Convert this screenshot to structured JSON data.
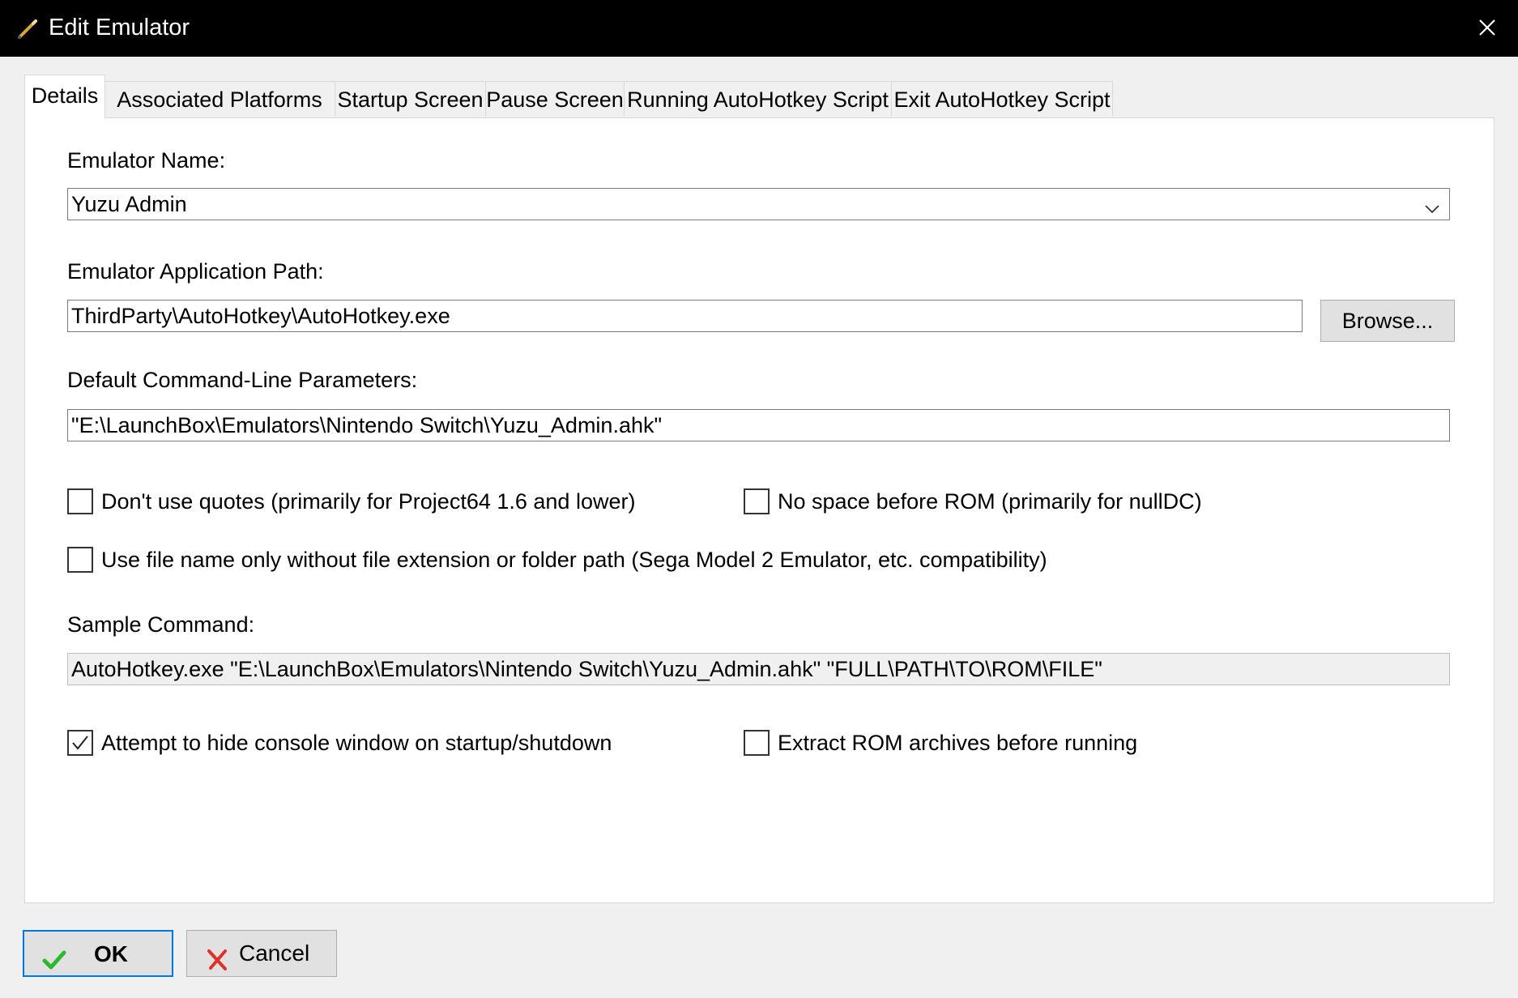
{
  "window": {
    "title": "Edit Emulator",
    "title_icon": "pencil-icon",
    "close_icon": "close-icon"
  },
  "tabs": [
    {
      "label": "Details",
      "active": true
    },
    {
      "label": "Associated Platforms",
      "active": false
    },
    {
      "label": "Startup Screen",
      "active": false
    },
    {
      "label": "Pause Screen",
      "active": false
    },
    {
      "label": "Running AutoHotkey Script",
      "active": false
    },
    {
      "label": "Exit AutoHotkey Script",
      "active": false
    }
  ],
  "details": {
    "emulator_name": {
      "label": "Emulator Name:",
      "value": "Yuzu Admin"
    },
    "application_path": {
      "label": "Emulator Application Path:",
      "value": "ThirdParty\\AutoHotkey\\AutoHotkey.exe",
      "browse_label": "Browse..."
    },
    "command_line": {
      "label": "Default Command-Line Parameters:",
      "value": "\"E:\\LaunchBox\\Emulators\\Nintendo Switch\\Yuzu_Admin.ahk\""
    },
    "options": {
      "dont_use_quotes": {
        "label": "Don't use quotes (primarily for Project64 1.6 and lower)",
        "checked": false
      },
      "no_space_before_rom": {
        "label": "No space before ROM (primarily for nullDC)",
        "checked": false
      },
      "file_name_only": {
        "label": "Use file name only without file extension or folder path (Sega Model 2 Emulator, etc. compatibility)",
        "checked": false
      },
      "hide_console": {
        "label": "Attempt to hide console window on startup/shutdown",
        "checked": true
      },
      "extract_rom": {
        "label": "Extract ROM archives before running",
        "checked": false
      }
    },
    "sample_command": {
      "label": "Sample Command:",
      "value": "AutoHotkey.exe \"E:\\LaunchBox\\Emulators\\Nintendo Switch\\Yuzu_Admin.ahk\" \"FULL\\PATH\\TO\\ROM\\FILE\""
    }
  },
  "footer": {
    "ok_label": "OK",
    "cancel_label": "Cancel"
  },
  "colors": {
    "titlebar_bg": "#000000",
    "focus_border": "#0078d7",
    "ok_check": "#2eb82e",
    "cancel_x": "#e0302a"
  }
}
